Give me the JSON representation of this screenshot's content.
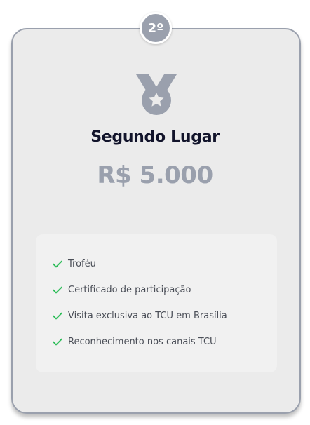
{
  "card": {
    "rank": "2º",
    "medal_icon": "medal-icon",
    "title": "Segundo Lugar",
    "prize": "R$ 5.000",
    "benefits": [
      {
        "label": "Troféu",
        "icon": "check-icon"
      },
      {
        "label": "Certificado de participação",
        "icon": "check-icon"
      },
      {
        "label": "Visita exclusiva ao TCU em Brasília",
        "icon": "check-icon"
      },
      {
        "label": "Reconhecimento nos canais TCU",
        "icon": "check-icon"
      }
    ]
  },
  "colors": {
    "silver": "#9aa0ad",
    "card_bg": "#ebebeb",
    "title": "#12142b",
    "check": "#2ebd59",
    "text": "#4a4e57"
  }
}
